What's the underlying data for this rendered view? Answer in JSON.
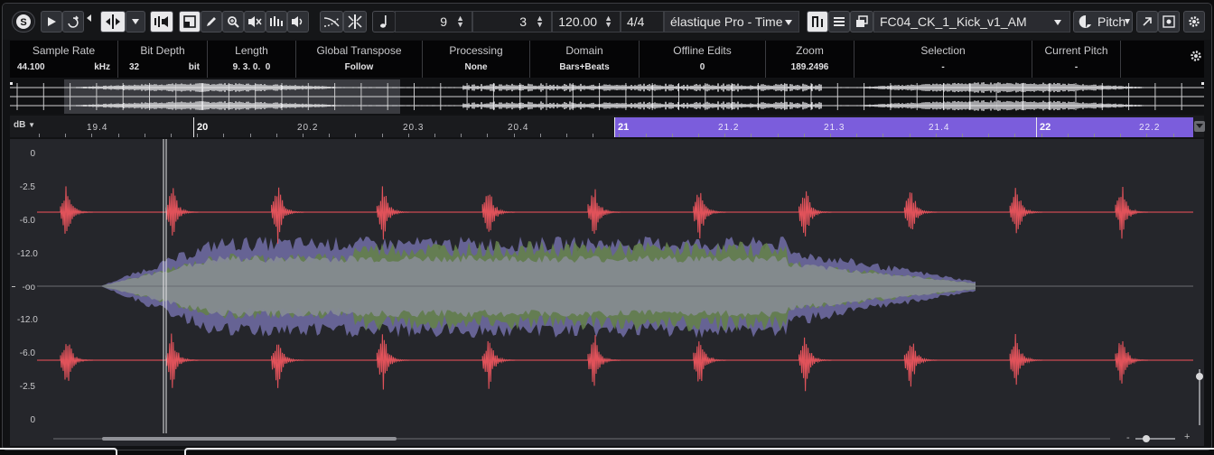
{
  "toolbar": {
    "algorithm": "élastique Pro - Time",
    "numerator": "9",
    "denominator": "3",
    "tempo": "120.00",
    "signature": "4/4",
    "sample_name": "FC04_CK_1_Kick_v1_AM",
    "pitch_label": "Pitch",
    "chevron": "▾"
  },
  "info_line": {
    "sample_rate": {
      "label": "Sample Rate",
      "value": "44.100",
      "unit": "kHz"
    },
    "bit_depth": {
      "label": "Bit Depth",
      "value": "32",
      "unit": "bit"
    },
    "length": {
      "label": "Length",
      "value": "9. 3. 0.  0"
    },
    "global_transpose": {
      "label": "Global Transpose",
      "value": "Follow"
    },
    "processing": {
      "label": "Processing",
      "value": "None"
    },
    "domain": {
      "label": "Domain",
      "value": "Bars+Beats"
    },
    "offline_edits": {
      "label": "Offline Edits",
      "value": "0"
    },
    "zoom": {
      "label": "Zoom",
      "value": "189.2496"
    },
    "selection": {
      "label": "Selection",
      "value": "-"
    },
    "current_pitch": {
      "label": "Current Pitch",
      "value": "-"
    }
  },
  "ruler": {
    "unit": "dB",
    "labels": [
      "19.4",
      "20",
      "20.2",
      "20.3",
      "20.4",
      "21",
      "21.2",
      "21.3",
      "21.4",
      "22",
      "22.2"
    ]
  },
  "y_labels_top": [
    "0",
    "-2.5",
    "-6.0",
    "-12.0",
    "-oo"
  ],
  "y_labels_bottom": [
    "-12.0",
    "-6.0",
    "-2.5",
    "0"
  ],
  "colors": {
    "kick": "#e0525a",
    "kick_line": "#c94a52",
    "pad_purple": "#6e6aa0",
    "pad_green": "#647f4a",
    "pad_grey": "#868b93",
    "selection": "#7b5ddc",
    "background": "#25262b"
  },
  "icons": [
    "solo-icon",
    "play-icon",
    "loop-icon",
    "snap-icon",
    "speaker-icon",
    "split-icon",
    "pencil-icon",
    "zoom-icon",
    "mute-icon",
    "bars-icon",
    "volume-icon",
    "crossfade-icon",
    "warp-icon",
    "note-icon",
    "hitpoints-icon",
    "stack-icon",
    "copy-icon",
    "pitch-icon",
    "export-icon",
    "settings-icon",
    "gear-icon"
  ]
}
